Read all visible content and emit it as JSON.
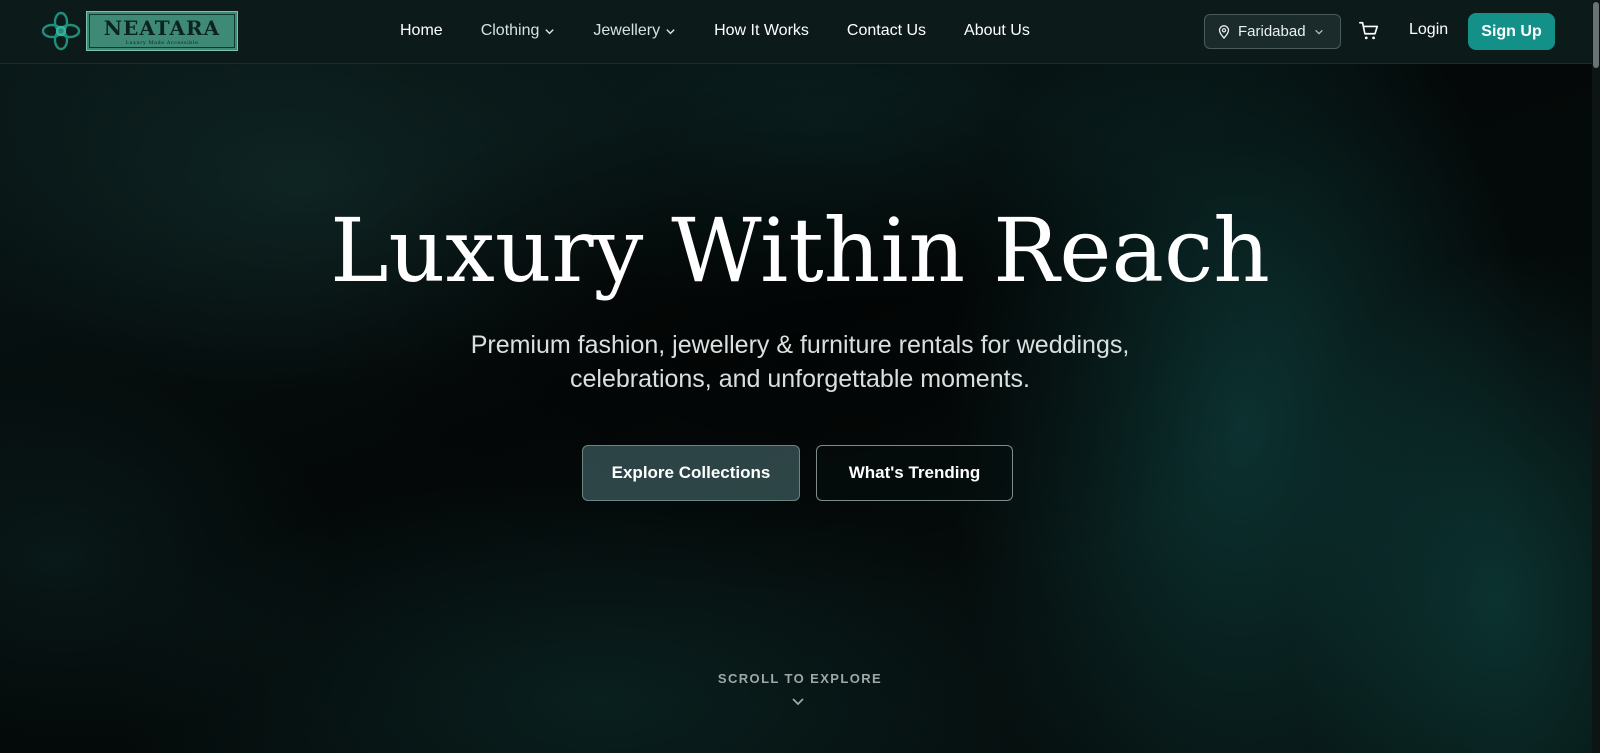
{
  "brand": {
    "name": "NEATARA",
    "tagline": "Luxury Made Accessible",
    "accent_color": "#139189"
  },
  "nav": {
    "items": [
      {
        "label": "Home",
        "has_dropdown": false
      },
      {
        "label": "Clothing",
        "has_dropdown": true
      },
      {
        "label": "Jewellery",
        "has_dropdown": true
      },
      {
        "label": "How It Works",
        "has_dropdown": false
      },
      {
        "label": "Contact Us",
        "has_dropdown": false
      },
      {
        "label": "About Us",
        "has_dropdown": false
      }
    ],
    "location": "Faridabad",
    "login_label": "Login",
    "signup_label": "Sign Up"
  },
  "hero": {
    "title": "Luxury Within Reach",
    "subtitle_line1": "Premium fashion, jewellery & furniture rentals for weddings,",
    "subtitle_line2": "celebrations, and unforgettable moments.",
    "primary_cta": "Explore Collections",
    "secondary_cta": "What's Trending",
    "scroll_hint": "SCROLL TO EXPLORE"
  },
  "icons": {
    "logo": "flower-knot-icon",
    "location": "map-pin-icon",
    "cart": "shopping-cart-icon",
    "dropdown": "chevron-down-icon",
    "scroll": "chevron-down-icon"
  }
}
